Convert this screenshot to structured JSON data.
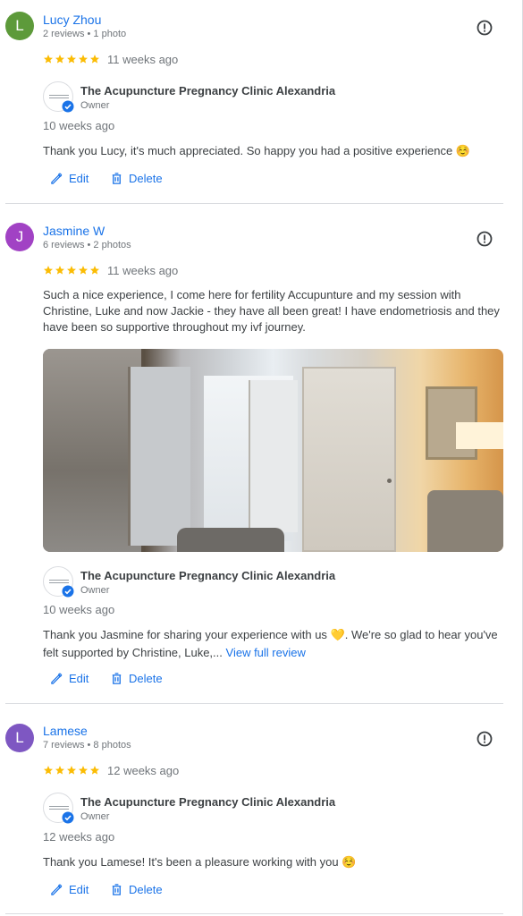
{
  "reviews": [
    {
      "initial": "L",
      "avatar_color": "#5d9a3a",
      "name": "Lucy Zhou",
      "meta": "2 reviews • 1 photo",
      "rating": 5,
      "date": "11 weeks ago",
      "owner": {
        "name": "The Acupuncture Pregnancy Clinic Alexandria",
        "label": "Owner",
        "date": "10 weeks ago",
        "text": "Thank you Lucy, it's much appreciated. So happy you had a positive experience ☺️"
      },
      "edit_label": "Edit",
      "delete_label": "Delete"
    },
    {
      "initial": "J",
      "avatar_color": "#a142c4",
      "name": "Jasmine W",
      "meta": "6 reviews • 2 photos",
      "rating": 5,
      "date": "11 weeks ago",
      "text": "Such a nice experience, I come here for fertility Accupunture and my session with Christine, Luke and now Jackie - they have all been great! I have endometriosis and they have been so supportive throughout my ivf journey.",
      "owner": {
        "name": "The Acupuncture Pregnancy Clinic Alexandria",
        "label": "Owner",
        "date": "10 weeks ago",
        "text": "Thank you Jasmine for sharing your experience with us 💛. We're so glad to hear you've felt supported by Christine, Luke,...",
        "view_full": "View full review"
      },
      "edit_label": "Edit",
      "delete_label": "Delete"
    },
    {
      "initial": "L",
      "avatar_color": "#7e57c2",
      "name": "Lamese",
      "meta": "7 reviews • 8 photos",
      "rating": 5,
      "date": "12 weeks ago",
      "owner": {
        "name": "The Acupuncture Pregnancy Clinic Alexandria",
        "label": "Owner",
        "date": "12 weeks ago",
        "text": "Thank you Lamese! It's been a pleasure working with you ☺️"
      },
      "edit_label": "Edit",
      "delete_label": "Delete"
    }
  ],
  "colors": {
    "accent": "#1a73e8",
    "star": "#fbbc04",
    "muted": "#70757a"
  }
}
